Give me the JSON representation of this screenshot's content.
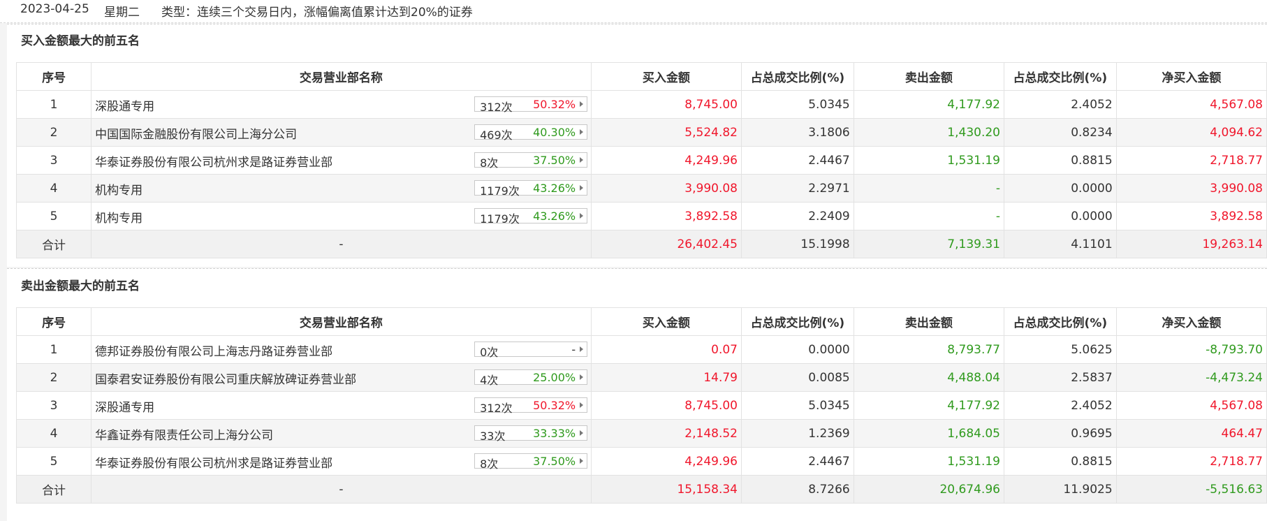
{
  "header": {
    "date": "2023-04-25",
    "weekday": "星期二",
    "type_text": "类型：连续三个交易日内，涨幅偏离值累计达到20%的证券"
  },
  "columns": [
    "序号",
    "交易营业部名称",
    "买入金额",
    "占总成交比例(%)",
    "卖出金额",
    "占总成交比例(%)",
    "净买入金额"
  ],
  "colors": {
    "rise": "#f0162b",
    "fall": "#2f9a1d"
  },
  "buy_section": {
    "title": "买入金额最大的前五名",
    "rows": [
      {
        "seq": "1",
        "name": "深股通专用",
        "count": "312次",
        "pct": "50.32%",
        "pct_color": "red",
        "buy": "8,745.00",
        "buy_ratio": "5.0345",
        "sell": "4,177.92",
        "sell_ratio": "2.4052",
        "net": "4,567.08",
        "net_color": "red"
      },
      {
        "seq": "2",
        "name": "中国国际金融股份有限公司上海分公司",
        "count": "469次",
        "pct": "40.30%",
        "pct_color": "green",
        "buy": "5,524.82",
        "buy_ratio": "3.1806",
        "sell": "1,430.20",
        "sell_ratio": "0.8234",
        "net": "4,094.62",
        "net_color": "red"
      },
      {
        "seq": "3",
        "name": "华泰证券股份有限公司杭州求是路证券营业部",
        "count": "8次",
        "pct": "37.50%",
        "pct_color": "green",
        "buy": "4,249.96",
        "buy_ratio": "2.4467",
        "sell": "1,531.19",
        "sell_ratio": "0.8815",
        "net": "2,718.77",
        "net_color": "red"
      },
      {
        "seq": "4",
        "name": "机构专用",
        "count": "1179次",
        "pct": "43.26%",
        "pct_color": "green",
        "buy": "3,990.08",
        "buy_ratio": "2.2971",
        "sell": "-",
        "sell_ratio": "0.0000",
        "net": "3,990.08",
        "net_color": "red"
      },
      {
        "seq": "5",
        "name": "机构专用",
        "count": "1179次",
        "pct": "43.26%",
        "pct_color": "green",
        "buy": "3,892.58",
        "buy_ratio": "2.2409",
        "sell": "-",
        "sell_ratio": "0.0000",
        "net": "3,892.58",
        "net_color": "red"
      }
    ],
    "total": {
      "label": "合计",
      "name": "-",
      "buy": "26,402.45",
      "buy_ratio": "15.1998",
      "sell": "7,139.31",
      "sell_ratio": "4.1101",
      "net": "19,263.14",
      "net_color": "red"
    }
  },
  "sell_section": {
    "title": "卖出金额最大的前五名",
    "rows": [
      {
        "seq": "1",
        "name": "德邦证券股份有限公司上海志丹路证券营业部",
        "count": "0次",
        "pct": "-",
        "pct_color": "dark",
        "buy": "0.07",
        "buy_ratio": "0.0000",
        "sell": "8,793.77",
        "sell_ratio": "5.0625",
        "net": "-8,793.70",
        "net_color": "green"
      },
      {
        "seq": "2",
        "name": "国泰君安证券股份有限公司重庆解放碑证券营业部",
        "count": "4次",
        "pct": "25.00%",
        "pct_color": "green",
        "buy": "14.79",
        "buy_ratio": "0.0085",
        "sell": "4,488.04",
        "sell_ratio": "2.5837",
        "net": "-4,473.24",
        "net_color": "green"
      },
      {
        "seq": "3",
        "name": "深股通专用",
        "count": "312次",
        "pct": "50.32%",
        "pct_color": "red",
        "buy": "8,745.00",
        "buy_ratio": "5.0345",
        "sell": "4,177.92",
        "sell_ratio": "2.4052",
        "net": "4,567.08",
        "net_color": "red"
      },
      {
        "seq": "4",
        "name": "华鑫证券有限责任公司上海分公司",
        "count": "33次",
        "pct": "33.33%",
        "pct_color": "green",
        "buy": "2,148.52",
        "buy_ratio": "1.2369",
        "sell": "1,684.05",
        "sell_ratio": "0.9695",
        "net": "464.47",
        "net_color": "red"
      },
      {
        "seq": "5",
        "name": "华泰证券股份有限公司杭州求是路证券营业部",
        "count": "8次",
        "pct": "37.50%",
        "pct_color": "green",
        "buy": "4,249.96",
        "buy_ratio": "2.4467",
        "sell": "1,531.19",
        "sell_ratio": "0.8815",
        "net": "2,718.77",
        "net_color": "red"
      }
    ],
    "total": {
      "label": "合计",
      "name": "-",
      "buy": "15,158.34",
      "buy_ratio": "8.7266",
      "sell": "20,674.96",
      "sell_ratio": "11.9025",
      "net": "-5,516.63",
      "net_color": "green"
    }
  }
}
